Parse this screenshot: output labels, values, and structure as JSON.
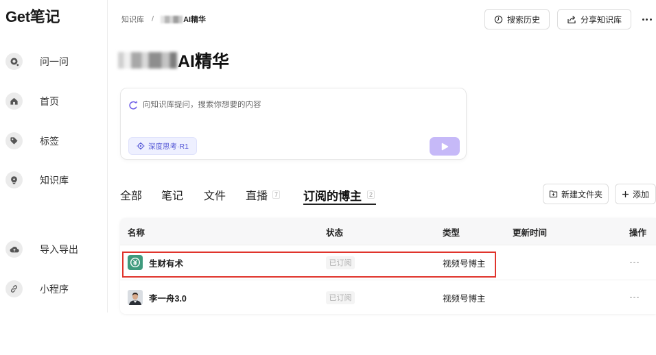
{
  "app": {
    "logo": "Get笔记"
  },
  "sidebar": {
    "items": [
      {
        "label": "问一问",
        "icon": "ai-chat-icon"
      },
      {
        "label": "首页",
        "icon": "home-icon"
      },
      {
        "label": "标签",
        "icon": "tag-icon"
      },
      {
        "label": "知识库",
        "icon": "bulb-icon"
      },
      {
        "label": "导入导出",
        "icon": "cloud-sync-icon"
      },
      {
        "label": "小程序",
        "icon": "link-icon"
      }
    ]
  },
  "header": {
    "breadcrumb": {
      "root": "知识库",
      "separator": "/",
      "current": "AI精华"
    },
    "search_history": {
      "label": "搜索历史",
      "icon": "clock-icon"
    },
    "share": {
      "label": "分享知识库",
      "icon": "share-icon"
    },
    "more_icon": "more-dots-icon"
  },
  "page": {
    "title": "AI精华"
  },
  "ask": {
    "icon": "ai-search-icon",
    "placeholder": "向知识库提问，搜索你想要的内容",
    "deep_think": {
      "label": "深度思考·R1",
      "icon": "deep-think-icon"
    },
    "send_icon": "send-icon"
  },
  "tabs": [
    {
      "label": "全部"
    },
    {
      "label": "笔记"
    },
    {
      "label": "文件"
    },
    {
      "label": "直播",
      "count": "7"
    },
    {
      "label": "订阅的博主",
      "count": "2",
      "active": true
    }
  ],
  "actions": {
    "new_folder": {
      "label": "新建文件夹",
      "icon": "new-folder-icon"
    },
    "add": {
      "label": "添加",
      "icon": "plus-icon"
    }
  },
  "table": {
    "columns": [
      "名称",
      "状态",
      "类型",
      "更新时间",
      "操作"
    ],
    "rows": [
      {
        "name": "生财有术",
        "avatar": "yuan-badge-icon",
        "status": "已订阅",
        "type": "视频号博主",
        "action_icon": "more-dots-icon",
        "highlighted": true
      },
      {
        "name": "李一舟3.0",
        "avatar": "person-avatar",
        "status": "已订阅",
        "type": "视频号博主",
        "action_icon": "more-dots-icon"
      }
    ]
  },
  "colors": {
    "accent_purple": "#6c5ce7",
    "send_button": "#c6b9f8",
    "deep_think_bg": "#eef0ff",
    "highlight_red": "#e0342c",
    "blogger_icon_green": "#3f9a7d"
  }
}
